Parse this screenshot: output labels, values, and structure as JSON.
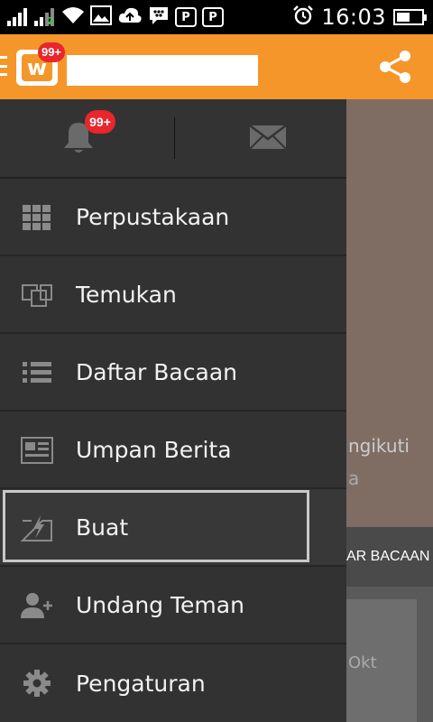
{
  "status_bar": {
    "time": "16:03",
    "battery_level": 0.55,
    "network_label": "2",
    "icons": [
      "signal-icon",
      "signal-2-icon",
      "wifi-icon",
      "image-icon",
      "cloud-upload-icon",
      "bbm-icon",
      "pinterest-icon",
      "pinterest-icon",
      "alarm-icon",
      "battery-icon"
    ]
  },
  "app_bar": {
    "logo_letter": "w",
    "notification_badge": "99+",
    "search_placeholder": "",
    "share_icon": "share-icon",
    "accent": "#f5962a"
  },
  "drawer": {
    "notifications_badge": "99+",
    "notifications_icon": "bell-icon",
    "messages_icon": "mail-icon",
    "items": [
      {
        "label": "Perpustakaan",
        "icon": "grid-icon"
      },
      {
        "label": "Temukan",
        "icon": "discover-icon"
      },
      {
        "label": "Daftar Bacaan",
        "icon": "list-icon"
      },
      {
        "label": "Umpan Berita",
        "icon": "newsfeed-icon"
      },
      {
        "label": "Buat",
        "icon": "create-icon"
      },
      {
        "label": "Undang Teman",
        "icon": "add-person-icon"
      },
      {
        "label": "Pengaturan",
        "icon": "gear-icon"
      }
    ],
    "selected_index": 4
  },
  "background": {
    "text_1": "ngikuti",
    "text_2": "a",
    "tab_label": "AR BACAAN",
    "card_text": "Okt"
  }
}
